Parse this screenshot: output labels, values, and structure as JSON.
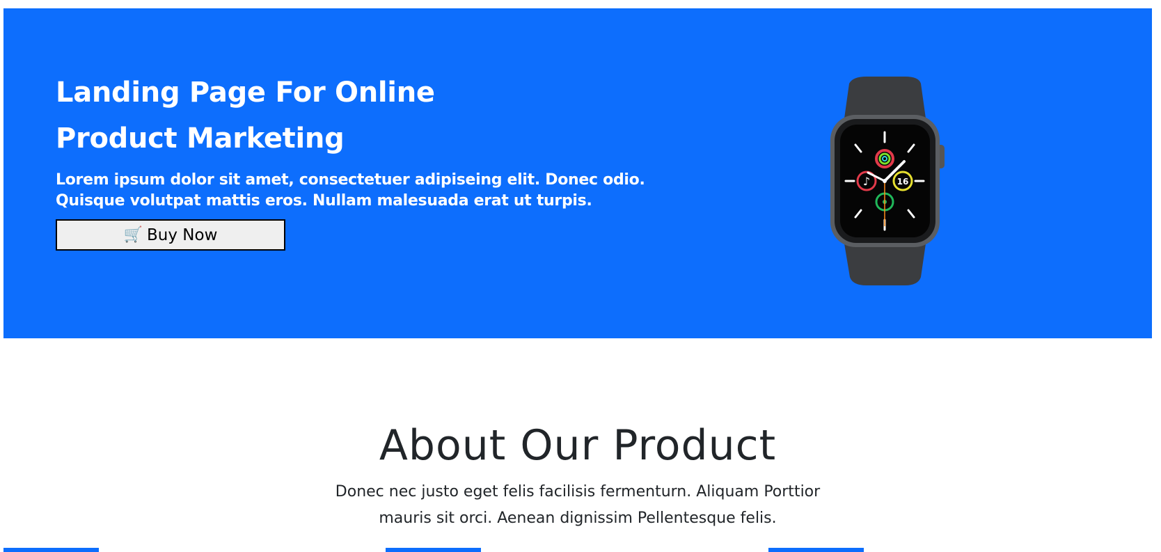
{
  "hero": {
    "title": "Landing Page For Online Product Marketing",
    "text": "Lorem ipsum dolor sit amet, consectetuer adipiseing elit. Donec odio. Quisque volutpat mattis eros. Nullam malesuada erat ut turpis.",
    "button_icon": "🛒",
    "button_label": "Buy Now",
    "watch_complication": "16"
  },
  "about": {
    "title": "About Our Product",
    "text": "Donec nec justo eget felis facilisis fermenturn. Aliquam Porttior mauris sit orci. Aenean dignissim Pellentesque felis."
  },
  "colors": {
    "primary": "#0d6efd",
    "text_dark": "#212529"
  },
  "icons": {
    "button": "shopping-cart-icon",
    "product": "smartwatch-image"
  }
}
